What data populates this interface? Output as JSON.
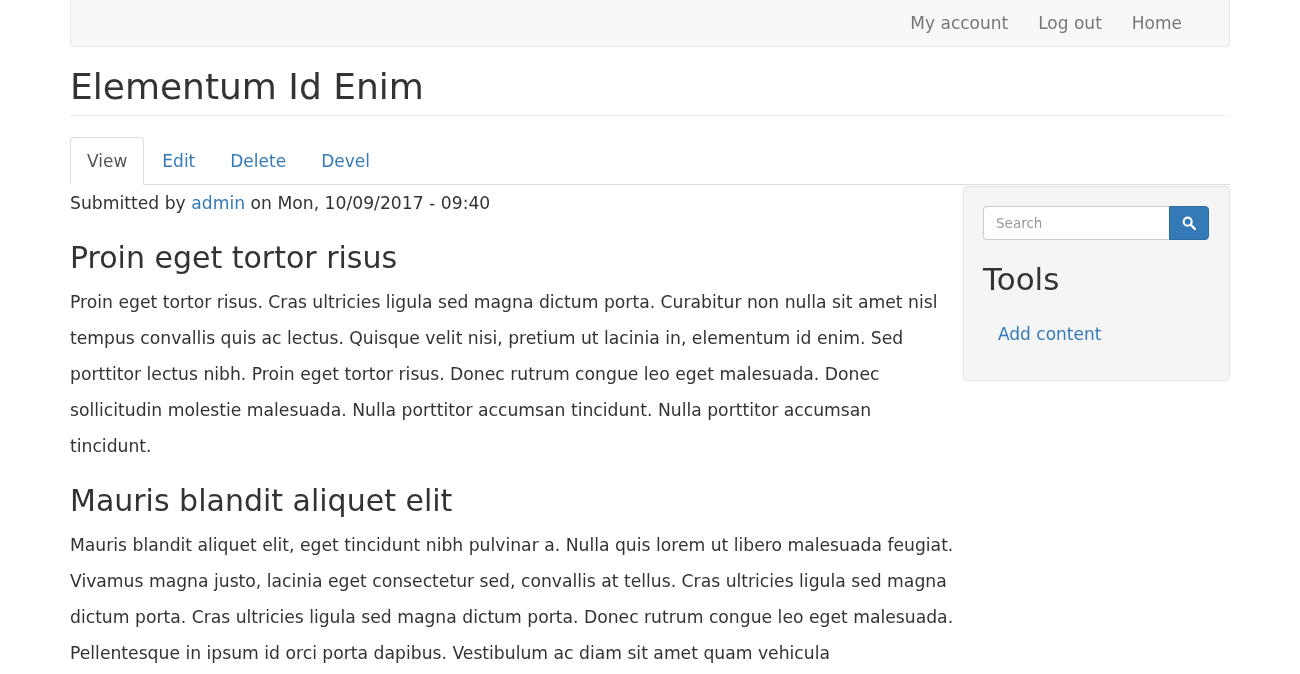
{
  "navbar": {
    "links": [
      "My account",
      "Log out",
      "Home"
    ]
  },
  "page_title": "Elementum Id Enim",
  "tabs": [
    {
      "label": "View",
      "selected": true
    },
    {
      "label": "Edit",
      "selected": false
    },
    {
      "label": "Delete",
      "selected": false
    },
    {
      "label": "Devel",
      "selected": false
    }
  ],
  "submitted": {
    "prefix": "Submitted by",
    "author": "admin",
    "suffix": "on Mon, 10/09/2017 - 09:40"
  },
  "sections": [
    {
      "heading": "Proin eget tortor risus",
      "body": "Proin eget tortor risus. Cras ultricies ligula sed magna dictum porta. Curabitur non nulla sit amet nisl tempus convallis quis ac lectus. Quisque velit nisi, pretium ut lacinia in, elementum id enim. Sed porttitor lectus nibh. Proin eget tortor risus. Donec rutrum congue leo eget malesuada. Donec sollicitudin molestie malesuada. Nulla porttitor accumsan tincidunt. Nulla porttitor accumsan tincidunt."
    },
    {
      "heading": "Mauris blandit aliquet elit",
      "body": "Mauris blandit aliquet elit, eget tincidunt nibh pulvinar a. Nulla quis lorem ut libero malesuada feugiat. Vivamus magna justo, lacinia eget consectetur sed, convallis at tellus. Cras ultricies ligula sed magna dictum porta. Cras ultricies ligula sed magna dictum porta. Donec rutrum congue leo eget malesuada. Pellentesque in ipsum id orci porta dapibus. Vestibulum ac diam sit amet quam vehicula"
    }
  ],
  "sidebar": {
    "search": {
      "placeholder": "Search"
    },
    "block_title": "Tools",
    "links": [
      "Add content"
    ]
  }
}
